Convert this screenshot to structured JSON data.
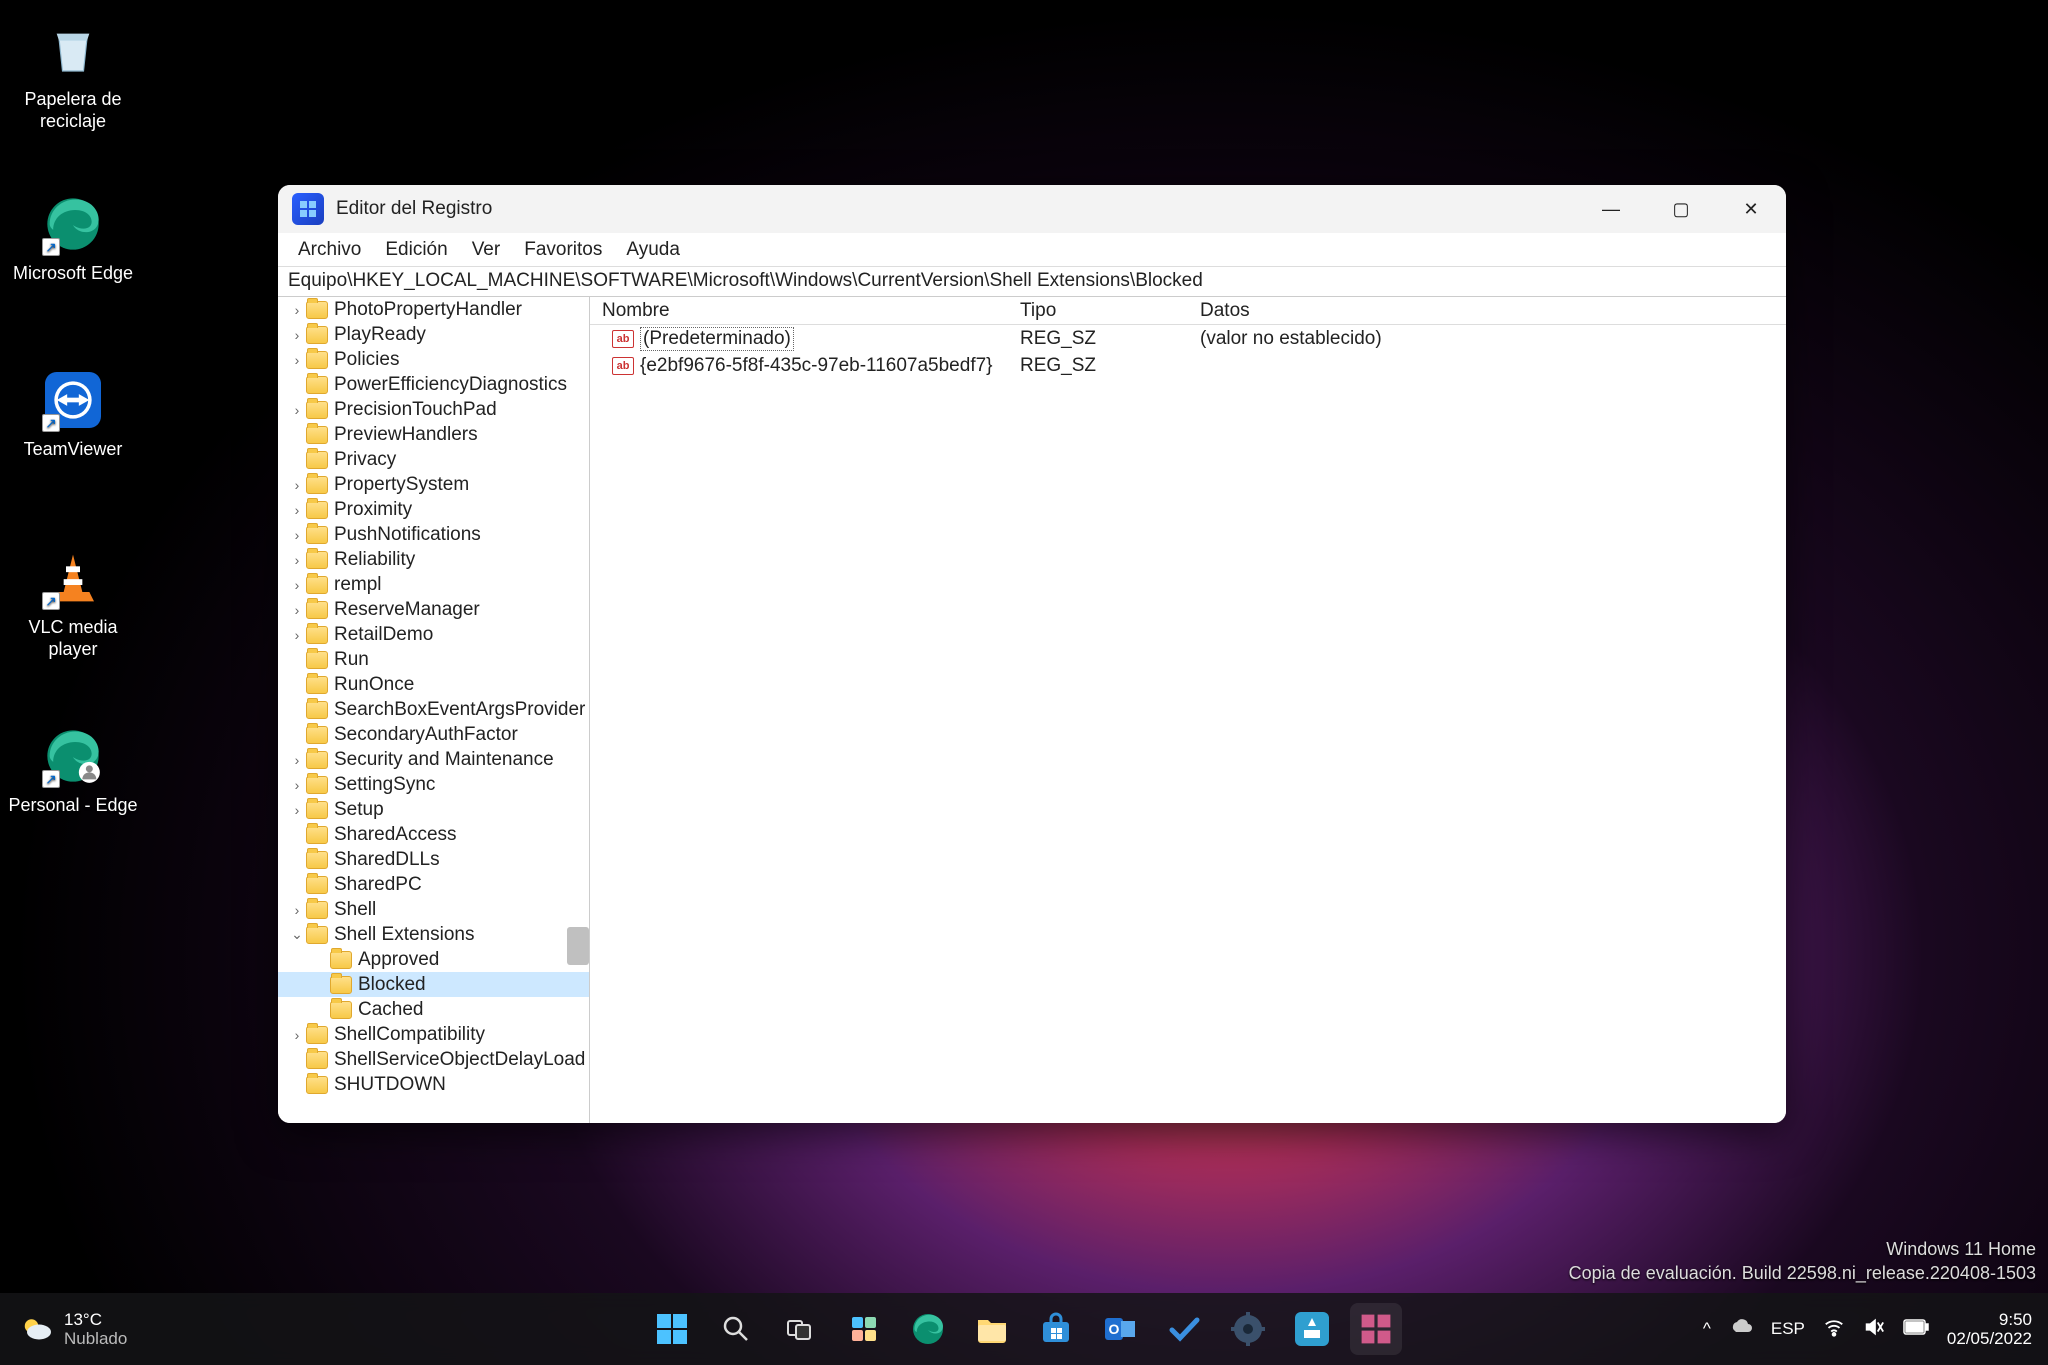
{
  "desktop": {
    "icons": [
      {
        "name": "recycle-bin",
        "label": "Papelera de\nreciclaje"
      },
      {
        "name": "edge",
        "label": "Microsoft Edge"
      },
      {
        "name": "teamviewer",
        "label": "TeamViewer"
      },
      {
        "name": "vlc",
        "label": "VLC media player"
      },
      {
        "name": "edge-personal",
        "label": "Personal - Edge"
      }
    ]
  },
  "window": {
    "title": "Editor del Registro",
    "menu": [
      "Archivo",
      "Edición",
      "Ver",
      "Favoritos",
      "Ayuda"
    ],
    "address": "Equipo\\HKEY_LOCAL_MACHINE\\SOFTWARE\\Microsoft\\Windows\\CurrentVersion\\Shell Extensions\\Blocked",
    "tree": [
      {
        "exp": ">",
        "indent": 10,
        "label": "PhotoPropertyHandler"
      },
      {
        "exp": ">",
        "indent": 10,
        "label": "PlayReady"
      },
      {
        "exp": ">",
        "indent": 10,
        "label": "Policies"
      },
      {
        "exp": "",
        "indent": 10,
        "label": "PowerEfficiencyDiagnostics"
      },
      {
        "exp": ">",
        "indent": 10,
        "label": "PrecisionTouchPad"
      },
      {
        "exp": "",
        "indent": 10,
        "label": "PreviewHandlers"
      },
      {
        "exp": "",
        "indent": 10,
        "label": "Privacy"
      },
      {
        "exp": ">",
        "indent": 10,
        "label": "PropertySystem"
      },
      {
        "exp": ">",
        "indent": 10,
        "label": "Proximity"
      },
      {
        "exp": ">",
        "indent": 10,
        "label": "PushNotifications"
      },
      {
        "exp": ">",
        "indent": 10,
        "label": "Reliability"
      },
      {
        "exp": ">",
        "indent": 10,
        "label": "rempl"
      },
      {
        "exp": ">",
        "indent": 10,
        "label": "ReserveManager"
      },
      {
        "exp": ">",
        "indent": 10,
        "label": "RetailDemo"
      },
      {
        "exp": "",
        "indent": 10,
        "label": "Run"
      },
      {
        "exp": "",
        "indent": 10,
        "label": "RunOnce"
      },
      {
        "exp": "",
        "indent": 10,
        "label": "SearchBoxEventArgsProvider"
      },
      {
        "exp": "",
        "indent": 10,
        "label": "SecondaryAuthFactor"
      },
      {
        "exp": ">",
        "indent": 10,
        "label": "Security and Maintenance"
      },
      {
        "exp": ">",
        "indent": 10,
        "label": "SettingSync"
      },
      {
        "exp": ">",
        "indent": 10,
        "label": "Setup"
      },
      {
        "exp": "",
        "indent": 10,
        "label": "SharedAccess"
      },
      {
        "exp": "",
        "indent": 10,
        "label": "SharedDLLs"
      },
      {
        "exp": "",
        "indent": 10,
        "label": "SharedPC"
      },
      {
        "exp": ">",
        "indent": 10,
        "label": "Shell"
      },
      {
        "exp": "v",
        "indent": 10,
        "label": "Shell Extensions"
      },
      {
        "exp": "",
        "indent": 34,
        "label": "Approved"
      },
      {
        "exp": "",
        "indent": 34,
        "label": "Blocked",
        "selected": true
      },
      {
        "exp": "",
        "indent": 34,
        "label": "Cached"
      },
      {
        "exp": ">",
        "indent": 10,
        "label": "ShellCompatibility"
      },
      {
        "exp": "",
        "indent": 10,
        "label": "ShellServiceObjectDelayLoad"
      },
      {
        "exp": "",
        "indent": 10,
        "label": "SHUTDOWN"
      }
    ],
    "columns": {
      "name": "Nombre",
      "type": "Tipo",
      "data": "Datos"
    },
    "values": [
      {
        "name": "(Predeterminado)",
        "type": "REG_SZ",
        "data": "(valor no establecido)",
        "boxed": true
      },
      {
        "name": "{e2bf9676-5f8f-435c-97eb-11607a5bedf7}",
        "type": "REG_SZ",
        "data": ""
      }
    ]
  },
  "watermark": {
    "line1": "Windows 11 Home",
    "line2": "Copia de evaluación. Build 22598.ni_release.220408-1503"
  },
  "taskbar": {
    "weather": {
      "temp": "13°C",
      "cond": "Nublado"
    },
    "lang": "ESP",
    "time": "9:50",
    "date": "02/05/2022"
  }
}
